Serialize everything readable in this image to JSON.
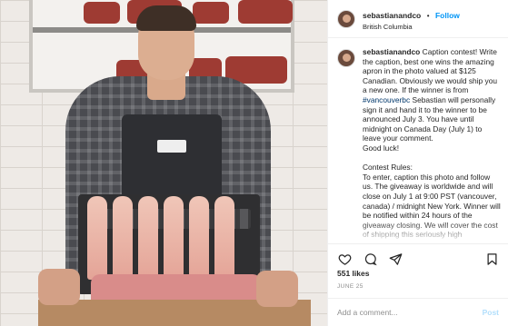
{
  "post": {
    "username": "sebastianandco",
    "separator": "•",
    "follow_label": "Follow",
    "location": "British Columbia",
    "caption": {
      "username": "sebastianandco",
      "text_before_hashtag": " Caption contest! Write the caption, best one wins the amazing apron in the photo valued at $125 Canadian. Obviously we would ship you a new one. If the winner is from ",
      "hashtag": "#vancouverbc",
      "text_after_hashtag": " Sebastian will personally sign it and hand it to the winner to be announced July 3. You have until midnight on Canada Day (July 1) to leave your comment.\nGood luck!\n\nContest Rules:\nTo enter, caption this photo and follow us. The giveaway is worldwide and will close on July 1 at 9:00 PST (vancouver, canada) / midnight New York. Winner will be notified within 24 hours of the giveaway closing. We will cover the cost of shipping this seriously high"
    },
    "likes": "551 likes",
    "date": "JUNE 25",
    "comment_placeholder": "Add a comment...",
    "post_button": "Post"
  },
  "photo": {
    "apron_tag_alt": "SEBASTIAN & CO"
  },
  "icons": {
    "like": "heart-icon",
    "comment": "comment-bubble-icon",
    "share": "paper-plane-icon",
    "save": "bookmark-icon"
  },
  "colors": {
    "link_blue": "#0095f6",
    "hashtag": "#00376b",
    "muted": "#8e8e8e",
    "post_disabled": "#b2dffc"
  }
}
